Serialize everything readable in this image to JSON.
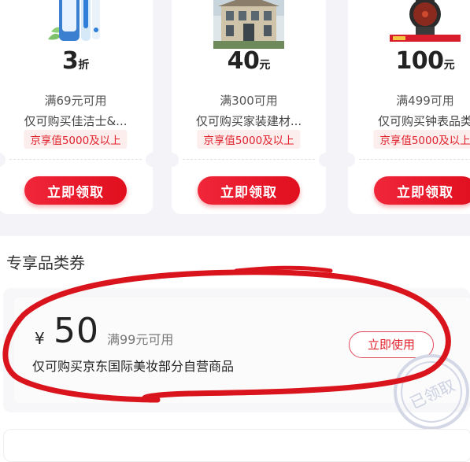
{
  "coupons": [
    {
      "value": "3",
      "unit": "折",
      "condition": "满69元可用",
      "scope": "仅可购买佳洁士&...",
      "tag": "京享值5000及以上",
      "button": "立即领取",
      "image_icon": "toothbrush-product-image"
    },
    {
      "value": "40",
      "unit": "元",
      "condition": "满300可用",
      "scope": "仅可购买家装建材...",
      "tag": "京享值5000及以上",
      "button": "立即领取",
      "image_icon": "villa-house-image"
    },
    {
      "value": "100",
      "unit": "元",
      "condition": "满499可用",
      "scope": "仅可购买钟表品类",
      "tag": "京享值5000及以上",
      "button": "立即领取",
      "image_icon": "wristwatch-product-image"
    }
  ],
  "section_title": "专享品类券",
  "exclusive_coupon": {
    "currency": "¥",
    "amount": "50",
    "condition": "满99元可用",
    "scope": "仅可购买京东国际美妆部分自营商品",
    "button": "立即使用",
    "stamp_text": "已领取"
  },
  "colors": {
    "brand_red": "#e10f1e",
    "tag_bg": "#fdeeee",
    "annotation_red": "#d9141c"
  }
}
